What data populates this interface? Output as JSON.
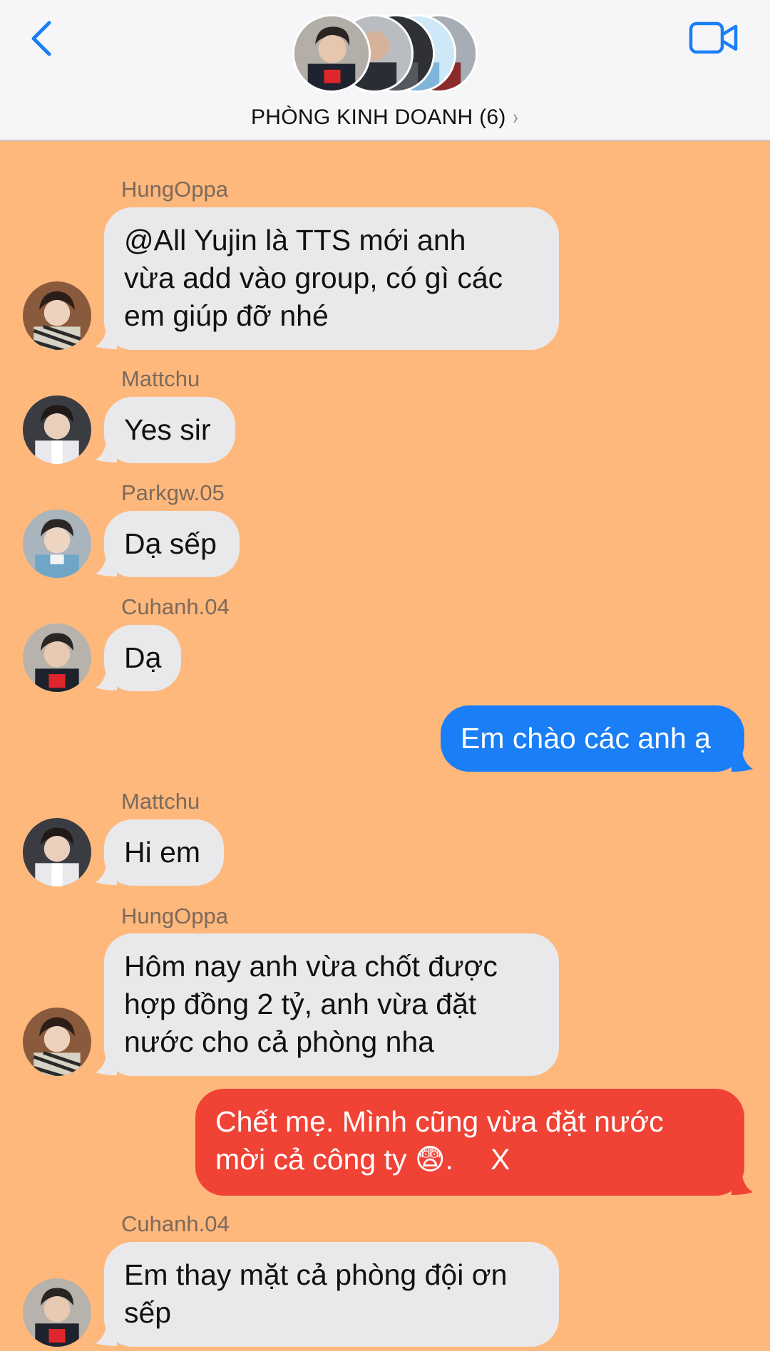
{
  "header": {
    "back_icon": "chevron-left-icon",
    "video_icon": "video-camera-icon",
    "title": "PHÒNG KINH DOANH (6)",
    "title_chevron": "›",
    "accent_color": "#1a7ef6"
  },
  "chat": {
    "background_color": "#ffb87c",
    "messages": [
      {
        "sender": "HungOppa",
        "direction": "incoming",
        "text": "@All Yujin là TTS mới anh vừa add vào group, có gì các em giúp đỡ nhé",
        "lines": [
          "@All Yujin là TTS mới anh",
          "vừa add vào group, có gì các",
          "em giúp đỡ nhé"
        ]
      },
      {
        "sender": "Mattchu",
        "direction": "incoming",
        "text": "Yes sir"
      },
      {
        "sender": "Parkgw.05",
        "direction": "incoming",
        "text": "Dạ sếp"
      },
      {
        "sender": "Cuhanh.04",
        "direction": "incoming",
        "text": "Dạ"
      },
      {
        "direction": "outgoing",
        "text": "Em chào các anh ạ",
        "color": "#1a7ef6"
      },
      {
        "sender": "Mattchu",
        "direction": "incoming",
        "text": "Hi em"
      },
      {
        "sender": "HungOppa",
        "direction": "incoming",
        "text": "Hôm nay anh vừa chốt được hợp đồng 2 tỷ, anh vừa đặt nước cho cả phòng nha",
        "lines": [
          "Hôm nay anh vừa chốt được",
          "hợp đồng 2 tỷ, anh vừa đặt",
          "nước cho cả phòng nha"
        ]
      },
      {
        "direction": "outgoing",
        "color": "#f04235",
        "lines": [
          "Chết mẹ. Mình cũng vừa đặt nước",
          "mời cả công ty 😨."
        ],
        "mark": "X"
      },
      {
        "sender": "Cuhanh.04",
        "direction": "incoming",
        "text": "Em thay mặt cả phòng đội ơn sếp",
        "lines": [
          "Em thay mặt cả phòng đội ơn",
          "sếp"
        ]
      }
    ]
  }
}
